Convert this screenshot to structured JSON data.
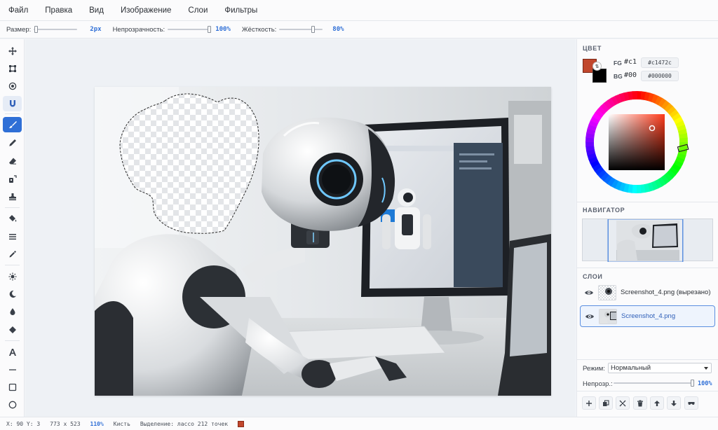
{
  "menu": {
    "items": [
      "Файл",
      "Правка",
      "Вид",
      "Изображение",
      "Слои",
      "Фильтры"
    ]
  },
  "options": {
    "size_label": "Размер:",
    "size_value": "2px",
    "size_fraction": 0.02,
    "opacity_label": "Непрозрачность:",
    "opacity_value": "100%",
    "opacity_fraction": 1.0,
    "hardness_label": "Жёсткость:",
    "hardness_value": "80%",
    "hardness_fraction": 0.8
  },
  "tools": {
    "items": [
      {
        "name": "move-tool",
        "icon": "move-icon",
        "active": false
      },
      {
        "name": "crop-tool",
        "icon": "crop-icon",
        "active": false
      },
      {
        "name": "ellipse-select-tool",
        "icon": "target-icon",
        "active": false
      },
      {
        "name": "magnet-lasso-tool",
        "icon": "magnet-icon",
        "active": false,
        "hover": true
      },
      {
        "name": "brush-tool",
        "icon": "brush-icon",
        "active": true
      },
      {
        "name": "pencil-tool",
        "icon": "pencil-icon",
        "active": false
      },
      {
        "name": "eraser-tool",
        "icon": "eraser-icon",
        "active": false
      },
      {
        "name": "clone-tool",
        "icon": "clone-icon",
        "active": false
      },
      {
        "name": "stamp-tool",
        "icon": "stamp-icon",
        "active": false
      },
      {
        "name": "fill-tool",
        "icon": "bucket-icon",
        "active": false
      },
      {
        "name": "gradient-tool",
        "icon": "lines-icon",
        "active": false
      },
      {
        "name": "eyedropper-tool",
        "icon": "eyedropper-icon",
        "active": false
      },
      {
        "name": "dodge-tool",
        "icon": "sun-icon",
        "active": false
      },
      {
        "name": "burn-tool",
        "icon": "moon-icon",
        "active": false
      },
      {
        "name": "blur-tool",
        "icon": "drop-icon",
        "active": false
      },
      {
        "name": "sharpen-tool",
        "icon": "diamond-icon",
        "active": false
      },
      {
        "name": "text-tool",
        "icon": "text-icon",
        "active": false
      },
      {
        "name": "line-tool",
        "icon": "line-icon",
        "active": false
      },
      {
        "name": "rect-tool",
        "icon": "square-icon",
        "active": false
      },
      {
        "name": "ellipse-tool",
        "icon": "circle-icon",
        "active": false
      }
    ]
  },
  "color": {
    "title": "ЦВЕТ",
    "fg_label": "FG",
    "bg_label": "BG",
    "fg_hex_short": "#c1",
    "bg_hex_short": "#00",
    "fg_hex": "#c1472c",
    "bg_hex": "#000000",
    "fg_color": "#c1472c",
    "bg_color": "#000000"
  },
  "navigator": {
    "title": "НАВИГАТОР"
  },
  "layers": {
    "title": "СЛОИ",
    "items": [
      {
        "name": "Screenshot_4.png (вырезано)",
        "selected": false
      },
      {
        "name": "Screenshot_4.png",
        "selected": true
      }
    ],
    "mode_label": "Режим:",
    "mode_value": "Нормальный",
    "opacity_label": "Непрозр.:",
    "opacity_value": "100%",
    "opacity_fraction": 1.0
  },
  "status": {
    "coords": "X: 90 Y: 3",
    "dimensions": "773 x 523",
    "zoom": "110%",
    "tool": "Кисть",
    "selection": "Выделение: лассо 212 точек"
  },
  "accent": "#2f6fd6"
}
